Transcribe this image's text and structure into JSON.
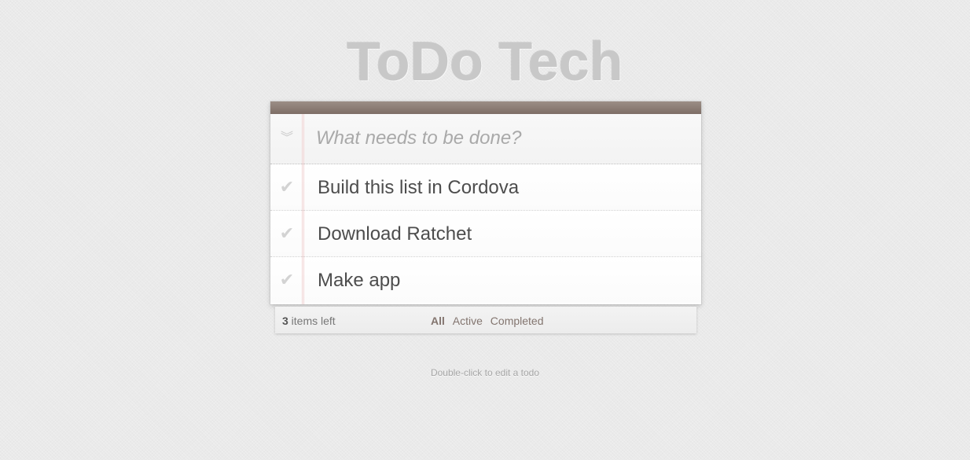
{
  "header": {
    "title": "ToDo Tech"
  },
  "new_todo": {
    "placeholder": "What needs to be done?",
    "value": "",
    "toggle_all_icon": "chevron-double-down-icon"
  },
  "todos": [
    {
      "label": "Build this list in Cordova",
      "completed": false,
      "check_icon": "checkmark-icon"
    },
    {
      "label": "Download Ratchet",
      "completed": false,
      "check_icon": "checkmark-icon"
    },
    {
      "label": "Make app",
      "completed": false,
      "check_icon": "checkmark-icon"
    }
  ],
  "footer": {
    "count": "3",
    "count_suffix": " items left",
    "filters": [
      {
        "label": "All",
        "selected": true
      },
      {
        "label": "Active",
        "selected": false
      },
      {
        "label": "Completed",
        "selected": false
      }
    ]
  },
  "info": {
    "text": "Double-click to edit a todo"
  },
  "colors": {
    "header_bar": "#8b7d75",
    "margin_line": "#f2d5d5",
    "filter_link": "#83756f",
    "title": "#c8c8c8"
  }
}
